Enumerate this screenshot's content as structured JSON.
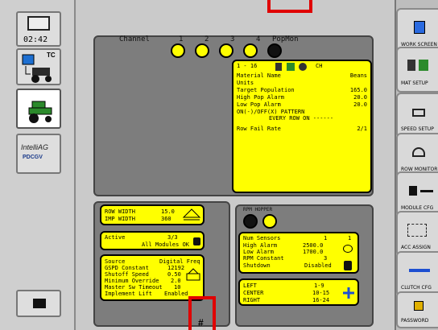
{
  "left_panel": {
    "clock": "02:42",
    "tractor_label": "TC",
    "logo_line1": "IntelliAG",
    "logo_line2": "PDCGV"
  },
  "channels": {
    "label": "Channel",
    "numbers": [
      "1",
      "2",
      "3",
      "4"
    ],
    "extra": "PopMon"
  },
  "detail": {
    "range": "1 - 16",
    "ch_label": "CH",
    "rows": [
      [
        "Material Name",
        "Beans"
      ],
      [
        "Units",
        ""
      ],
      [
        "Target Population",
        "165.0"
      ],
      [
        "High Pop Alarm",
        "20.0"
      ],
      [
        "Low Pop Alarm",
        "20.0"
      ]
    ],
    "pattern_line1": "ON(-)/OFF(X) PATTERN",
    "pattern_line2": "EVERY ROW ON ------",
    "fail_label": "Row Fail Rate",
    "fail_value": "2/1"
  },
  "width_box": {
    "row_width_label": "ROW WIDTH",
    "row_width_value": "15.0",
    "imp_width_label": "IMP WIDTH",
    "imp_width_value": "360"
  },
  "active_box": {
    "label": "Active",
    "value": "3/3",
    "status": "All Modules OK"
  },
  "source_box": {
    "rows": [
      [
        "Source",
        "Digital Freq"
      ],
      [
        "GSPD Constant",
        "12192"
      ],
      [
        "Shutoff Speed",
        "0.50"
      ],
      [
        "Minimum Override",
        "2.0"
      ],
      [
        "Master Sw Timeout",
        "10"
      ],
      [
        "Implement Lift",
        "Enabled"
      ]
    ]
  },
  "rpm_panel": {
    "title": "RPM HOPPER",
    "rows": [
      [
        "Num Sensors",
        "1",
        "1"
      ],
      [
        "High Alarm",
        "2500.0",
        ""
      ],
      [
        "Low Alarm",
        "1700.0",
        ""
      ],
      [
        "RPM Constant",
        "3",
        ""
      ],
      [
        "Shutdown",
        "Disabled",
        ""
      ]
    ]
  },
  "sections_box": {
    "rows": [
      [
        "LEFT",
        "1-9"
      ],
      [
        "CENTER",
        "10-15"
      ],
      [
        "RIGHT",
        "16-24"
      ]
    ]
  },
  "right_menu": [
    "WORK SCREEN",
    "MAT SETUP",
    "SPEED SETUP",
    "ROW MONITOR",
    "MODULE CFG",
    "ACC ASSIGN",
    "CLUTCH CFG",
    "PASSWORD"
  ],
  "annotation": {
    "hash": "#"
  },
  "colors": {
    "yellow": "#ffff00",
    "panel_gray": "#7d7d7d",
    "annotation_red": "#e00000"
  }
}
